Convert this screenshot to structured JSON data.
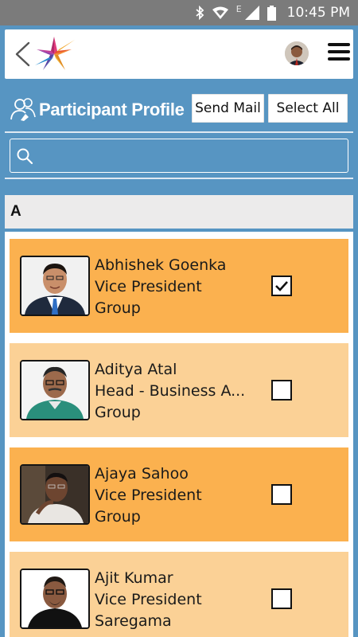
{
  "status_bar": {
    "time": "10:45 PM",
    "network_label": "E",
    "icons": [
      "bluetooth-icon",
      "wifi-icon",
      "signal-icon",
      "battery-icon"
    ]
  },
  "header": {
    "icons": [
      "back-arrow-icon",
      "app-logo",
      "user-avatar",
      "hamburger-menu-icon"
    ]
  },
  "page": {
    "title": "Participant Profile",
    "title_icon": "participants-icon",
    "send_mail_label": "Send Mail",
    "select_all_label": "Select All"
  },
  "search": {
    "placeholder": "",
    "value": "",
    "icon": "search-icon"
  },
  "section": {
    "letter": "A"
  },
  "participants": [
    {
      "name": "Abhishek Goenka",
      "designation": "Vice President",
      "company": "Group",
      "selected": true
    },
    {
      "name": "Aditya Atal",
      "designation": "Head - Business A...",
      "company": "Group",
      "selected": false
    },
    {
      "name": "Ajaya Sahoo",
      "designation": "Vice President",
      "company": "Group",
      "selected": false
    },
    {
      "name": "Ajit Kumar",
      "designation": "Vice President",
      "company": "Saregama",
      "selected": false
    }
  ],
  "colors": {
    "background": "#5795c2",
    "card_dark": "#fbb14f",
    "card_light": "#fbd196",
    "status_bar": "#7b7b7b"
  }
}
